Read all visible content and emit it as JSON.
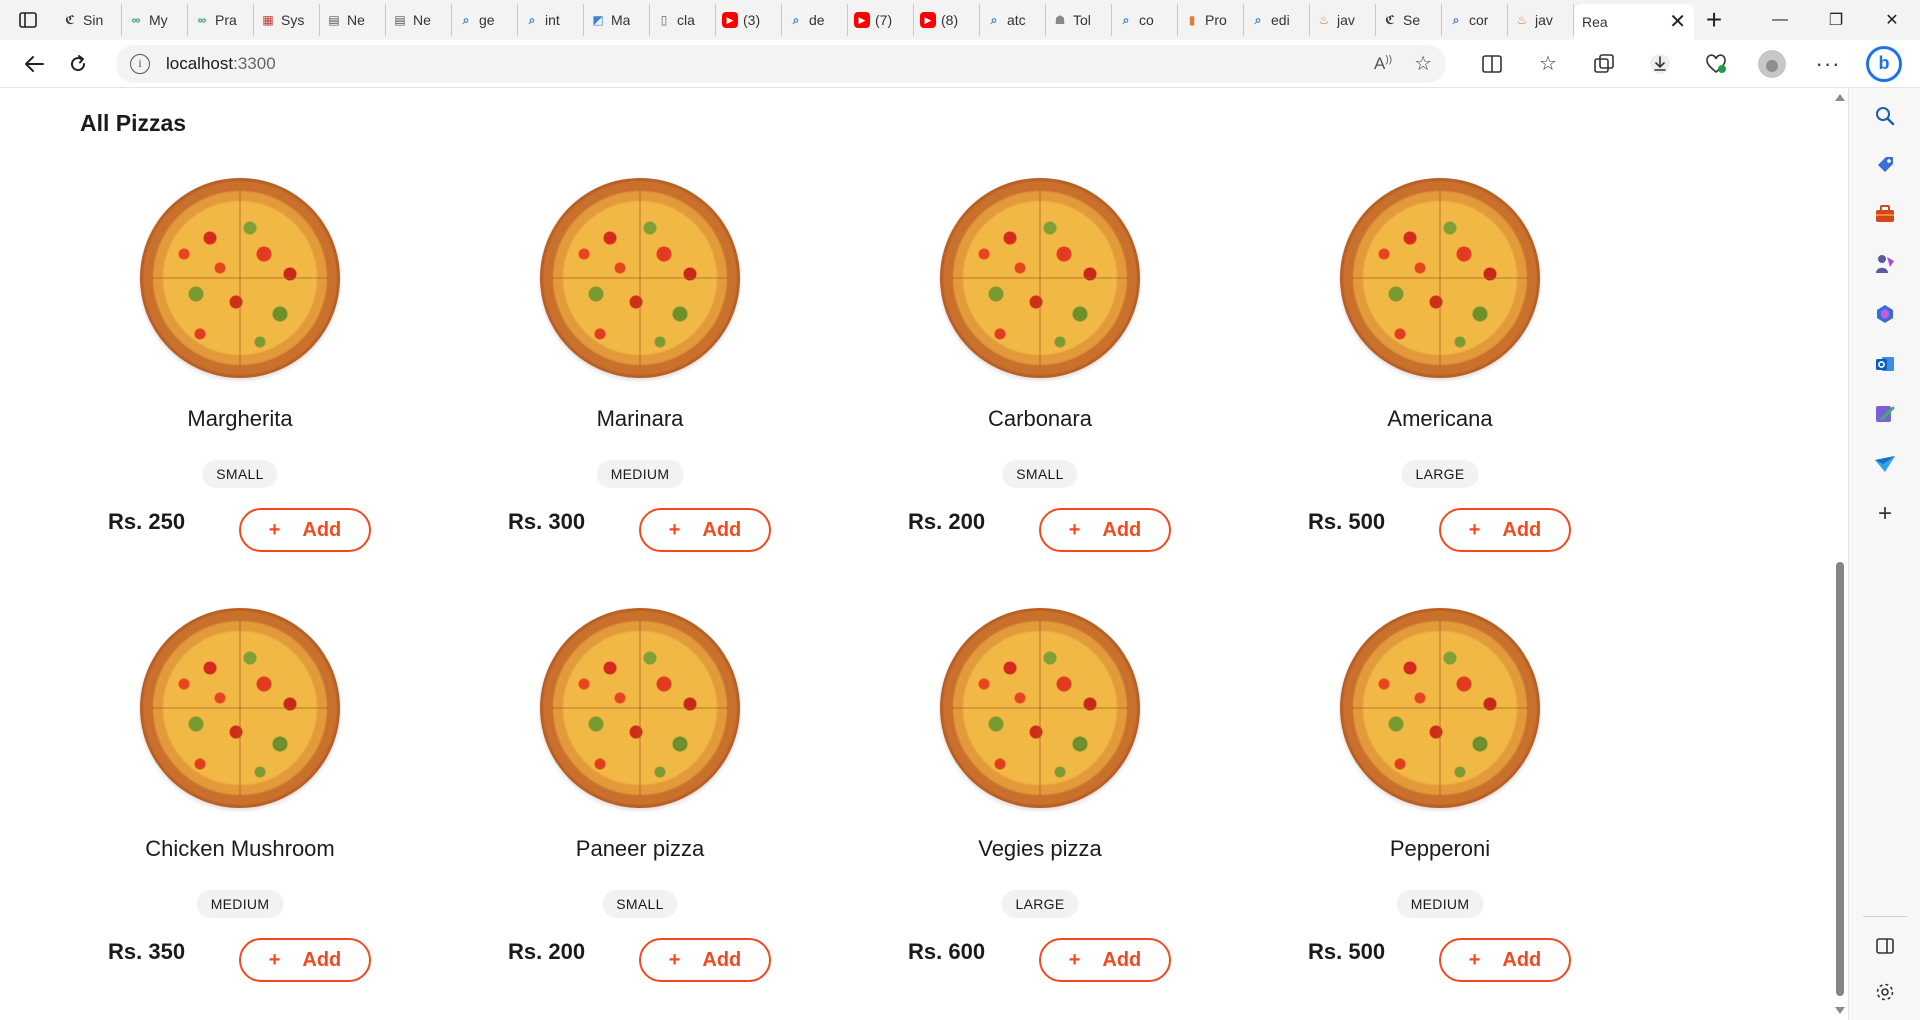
{
  "browser": {
    "tabs": [
      {
        "label": "Sin",
        "icon": "c-logo-icon"
      },
      {
        "label": "My",
        "icon": "infinity-icon"
      },
      {
        "label": "Pra",
        "icon": "infinity-icon"
      },
      {
        "label": "Sys",
        "icon": "calendar-icon"
      },
      {
        "label": "Ne",
        "icon": "page-icon"
      },
      {
        "label": "Ne",
        "icon": "page-icon"
      },
      {
        "label": "ge",
        "icon": "search-icon"
      },
      {
        "label": "int",
        "icon": "search-icon"
      },
      {
        "label": "Ma",
        "icon": "map-icon"
      },
      {
        "label": "cla",
        "icon": "document-icon"
      },
      {
        "label": "(3)",
        "icon": "youtube-icon"
      },
      {
        "label": "de",
        "icon": "search-icon"
      },
      {
        "label": "(7)",
        "icon": "youtube-icon"
      },
      {
        "label": "(8)",
        "icon": "youtube-icon"
      },
      {
        "label": "atc",
        "icon": "search-icon"
      },
      {
        "label": "Tol",
        "icon": "robot-icon"
      },
      {
        "label": "co",
        "icon": "search-icon"
      },
      {
        "label": "Pro",
        "icon": "chart-icon"
      },
      {
        "label": "edi",
        "icon": "search-icon"
      },
      {
        "label": "jav",
        "icon": "java-icon"
      },
      {
        "label": "Se",
        "icon": "c-logo-icon"
      },
      {
        "label": "cor",
        "icon": "search-icon"
      },
      {
        "label": "jav",
        "icon": "java-icon"
      }
    ],
    "active_tab": {
      "label": "Rea",
      "close": "✕"
    },
    "new_tab": "+",
    "window": {
      "minimize": "—",
      "maximize": "❐",
      "close": "✕"
    },
    "url_host": "localhost",
    "url_port": ":3300"
  },
  "page": {
    "title": "All Pizzas",
    "currency_prefix": "Rs. ",
    "add_label": "Add",
    "add_icon": "+",
    "pizzas": [
      {
        "name": "Margherita",
        "size": "SMALL",
        "price": "Rs. 250"
      },
      {
        "name": "Marinara",
        "size": "MEDIUM",
        "price": "Rs. 300"
      },
      {
        "name": "Carbonara",
        "size": "SMALL",
        "price": "Rs. 200"
      },
      {
        "name": "Americana",
        "size": "LARGE",
        "price": "Rs. 500"
      },
      {
        "name": "Chicken Mushroom",
        "size": "MEDIUM",
        "price": "Rs. 350"
      },
      {
        "name": "Paneer pizza",
        "size": "SMALL",
        "price": "Rs. 200"
      },
      {
        "name": "Vegies pizza",
        "size": "LARGE",
        "price": "Rs. 600"
      },
      {
        "name": "Pepperoni",
        "size": "MEDIUM",
        "price": "Rs. 500"
      }
    ]
  },
  "colors": {
    "accent": "#ef4b1e",
    "badge_bg": "#f2f2f2",
    "text": "#1b1b1b"
  }
}
